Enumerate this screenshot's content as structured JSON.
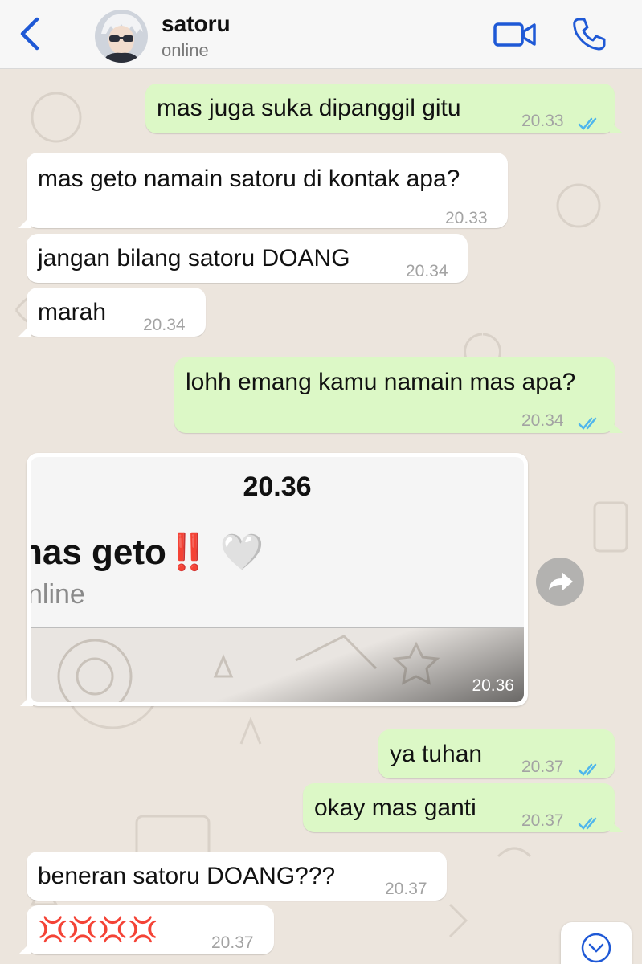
{
  "header": {
    "back_icon": "chevron-left-icon",
    "contact_name": "satoru",
    "status": "online",
    "video_icon": "video-camera-icon",
    "call_icon": "phone-icon",
    "accent_color": "#1f59d6"
  },
  "messages": [
    {
      "dir": "out",
      "text": "mas juga suka dipanggil gitu",
      "time": "20.33",
      "read": true
    },
    {
      "dir": "in",
      "text": "mas geto namain satoru di kontak apa?",
      "time": "20.33"
    },
    {
      "dir": "in",
      "text": "jangan bilang satoru DOANG",
      "time": "20.34"
    },
    {
      "dir": "in",
      "text": "marah",
      "time": "20.34"
    },
    {
      "dir": "out",
      "text": "lohh emang kamu namain mas apa?",
      "time": "20.34",
      "read": true
    },
    {
      "dir": "in",
      "type": "image",
      "time": "20.36",
      "screenshot": {
        "time": "20.36",
        "name": "nas geto",
        "emoji": "‼️ 🤍",
        "status": "nline"
      }
    },
    {
      "dir": "out",
      "text": "ya tuhan",
      "time": "20.37",
      "read": true
    },
    {
      "dir": "out",
      "text": "okay mas ganti",
      "time": "20.37",
      "read": true
    },
    {
      "dir": "in",
      "text": "beneran satoru DOANG???",
      "time": "20.37"
    },
    {
      "dir": "in",
      "text": "💢💢💢💢",
      "time": "20.37"
    }
  ],
  "controls": {
    "forward_icon": "forward-arrow-icon",
    "scroll_down_icon": "chevron-down-icon"
  },
  "colors": {
    "outgoing_bubble": "#dcf8c6",
    "incoming_bubble": "#ffffff",
    "chat_background": "#ece5dd",
    "read_ticks": "#4fb6ec",
    "anger_emoji": "#e0331c"
  }
}
